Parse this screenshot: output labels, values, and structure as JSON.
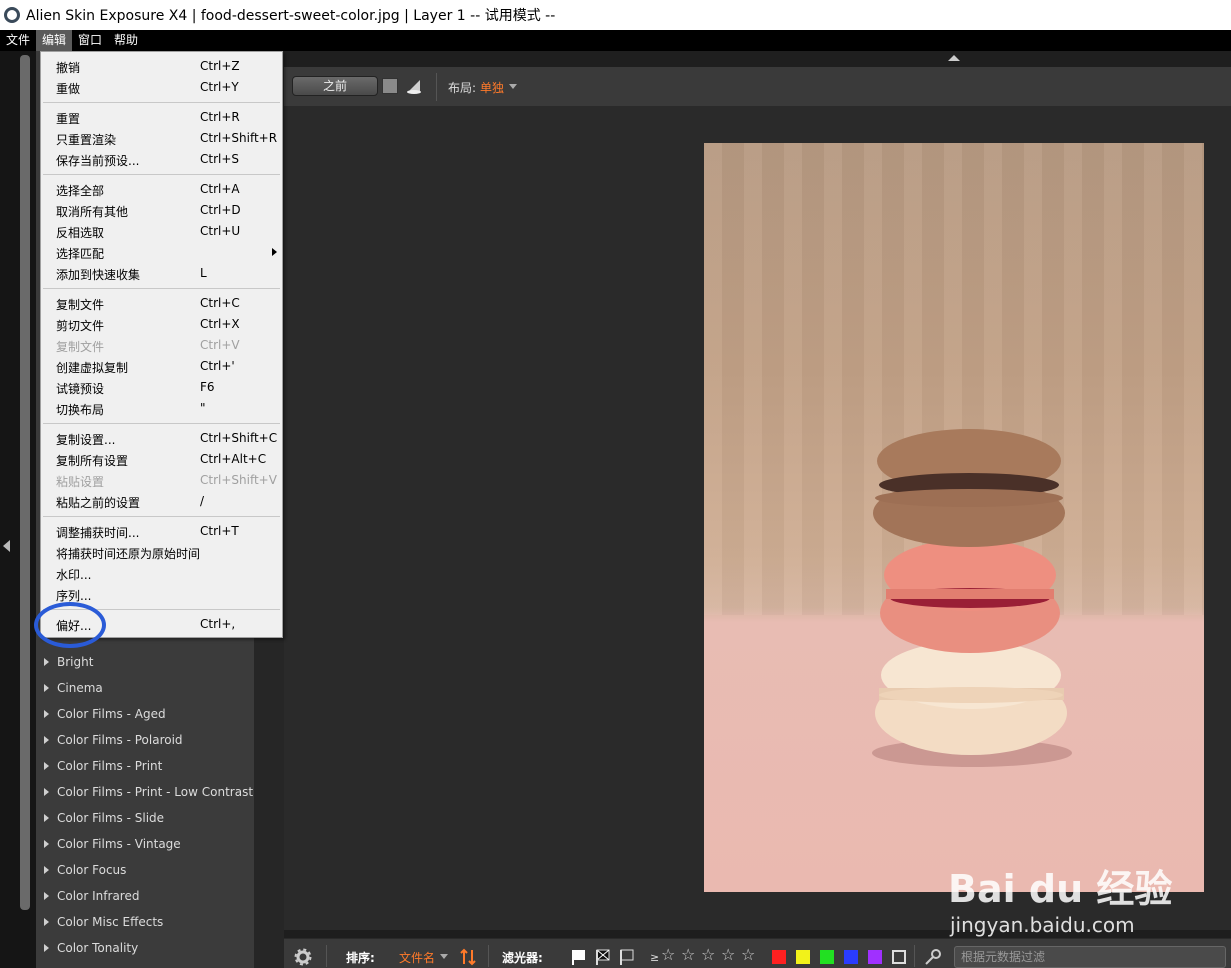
{
  "window": {
    "title": "Alien Skin Exposure X4 | food-dessert-sweet-color.jpg | Layer 1 -- 试用模式 --"
  },
  "menubar": {
    "items": [
      "文件",
      "编辑",
      "窗口",
      "帮助"
    ],
    "active_index": 1
  },
  "edit_menu": {
    "items": [
      {
        "label": "撤销",
        "shortcut": "Ctrl+Z",
        "disabled": false
      },
      {
        "label": "重做",
        "shortcut": "Ctrl+Y",
        "disabled": false
      },
      {
        "label": "重置",
        "shortcut": "Ctrl+R",
        "disabled": false
      },
      {
        "label": "只重置渲染",
        "shortcut": "Ctrl+Shift+R",
        "disabled": false
      },
      {
        "label": "保存当前预设...",
        "shortcut": "Ctrl+S",
        "disabled": false
      },
      {
        "label": "选择全部",
        "shortcut": "Ctrl+A",
        "disabled": false
      },
      {
        "label": "取消所有其他",
        "shortcut": "Ctrl+D",
        "disabled": false
      },
      {
        "label": "反相选取",
        "shortcut": "Ctrl+U",
        "disabled": false
      },
      {
        "label": "选择匹配",
        "shortcut": "",
        "disabled": false
      },
      {
        "label": "添加到快速收集",
        "shortcut": "L",
        "disabled": false
      },
      {
        "label": "复制文件",
        "shortcut": "Ctrl+C",
        "disabled": false
      },
      {
        "label": "剪切文件",
        "shortcut": "Ctrl+X",
        "disabled": false
      },
      {
        "label": "复制文件",
        "shortcut": "Ctrl+V",
        "disabled": true
      },
      {
        "label": "创建虚拟复制",
        "shortcut": "Ctrl+'",
        "disabled": false
      },
      {
        "label": "试镜预设",
        "shortcut": "F6",
        "disabled": false
      },
      {
        "label": "切换布局",
        "shortcut": "\"",
        "disabled": false
      },
      {
        "label": "复制设置...",
        "shortcut": "Ctrl+Shift+C",
        "disabled": false
      },
      {
        "label": "复制所有设置",
        "shortcut": "Ctrl+Alt+C",
        "disabled": false
      },
      {
        "label": "粘贴设置",
        "shortcut": "Ctrl+Shift+V",
        "disabled": true
      },
      {
        "label": "粘贴之前的设置",
        "shortcut": "/",
        "disabled": false
      },
      {
        "label": "调整捕获时间...",
        "shortcut": "Ctrl+T",
        "disabled": false
      },
      {
        "label": "将捕获时间还原为原始时间",
        "shortcut": "",
        "disabled": false
      },
      {
        "label": "水印...",
        "shortcut": "",
        "disabled": false
      },
      {
        "label": "序列...",
        "shortcut": "",
        "disabled": false
      },
      {
        "label": "偏好...",
        "shortcut": "Ctrl+,",
        "disabled": false
      }
    ]
  },
  "presets": {
    "items": [
      "Bright",
      "Cinema",
      "Color Films - Aged",
      "Color Films - Polaroid",
      "Color Films - Print",
      "Color Films - Print - Low Contrast",
      "Color Films - Slide",
      "Color Films - Vintage",
      "Color Focus",
      "Color Infrared",
      "Color Misc Effects",
      "Color Tonality"
    ]
  },
  "toolbar": {
    "before_label": "之前",
    "layout_label": "布局:",
    "layout_value": "单独"
  },
  "bottombar": {
    "sort_label": "排序:",
    "sort_value": "文件名",
    "filter_label": "滤光器:",
    "rating_prefix": "≥",
    "metadata_placeholder": "根据元数据过滤",
    "color_labels": [
      "#ff2020",
      "#f2f21a",
      "#22e022",
      "#2a3cff",
      "#a030ff"
    ]
  },
  "watermark": {
    "logo": "Bai du 经验",
    "url": "jingyan.baidu.com"
  },
  "colors": {
    "accent": "#ff7a2a",
    "highlight_circle": "#2a5bd7"
  }
}
